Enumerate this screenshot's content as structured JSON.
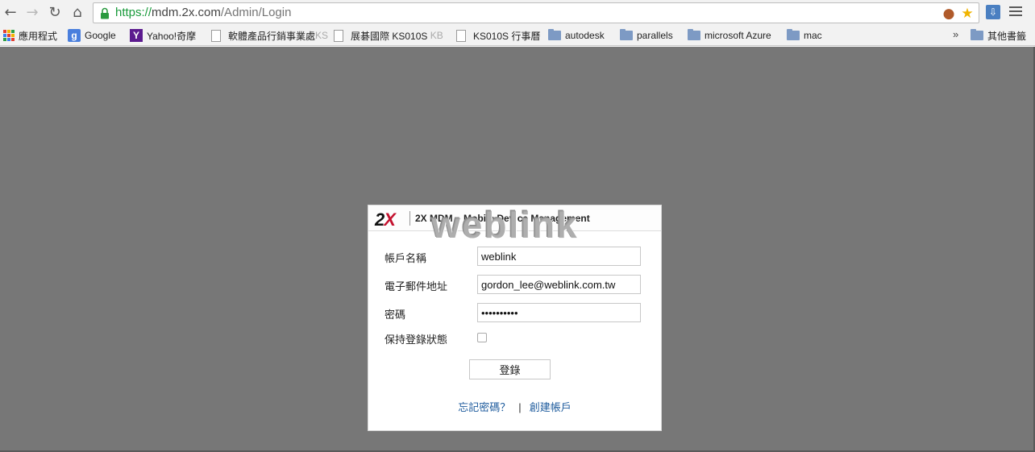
{
  "browser": {
    "url_scheme": "https://",
    "url_host": "mdm.2x.com",
    "url_path": "/Admin/Login",
    "icons": [
      "back-icon",
      "forward-icon",
      "reload-icon",
      "home-icon",
      "lock-icon",
      "extension-icon",
      "star-icon",
      "download-icon",
      "menu-icon"
    ]
  },
  "bookmarks": {
    "items": [
      {
        "label": "應用程式",
        "icon": "apps-icon"
      },
      {
        "label": "Google",
        "icon": "google-icon"
      },
      {
        "label": "Yahoo!奇摩",
        "icon": "yahoo-icon"
      },
      {
        "label": "軟體產品行銷事業處",
        "label_faded": "KS",
        "icon": "page-icon"
      },
      {
        "label": "展碁國際 KS010S",
        "label_faded": "KB",
        "icon": "page-icon"
      },
      {
        "label": "KS010S 行事曆",
        "icon": "page-icon"
      },
      {
        "label": "autodesk",
        "icon": "folder-icon"
      },
      {
        "label": "parallels",
        "icon": "folder-icon"
      },
      {
        "label": "microsoft Azure",
        "icon": "folder-icon"
      },
      {
        "label": "mac",
        "icon": "folder-icon"
      }
    ],
    "overflow": "»",
    "other": "其他書籤"
  },
  "login": {
    "logo_text": "2",
    "logo_x": "X",
    "product": "2X MDM – Mobile Device Management",
    "watermark": "weblink",
    "username_label": "帳戶名稱",
    "username_value": "weblink",
    "email_label": "電子郵件地址",
    "email_value": "gordon_lee@weblink.com.tw",
    "password_label": "密碼",
    "password_value": "••••••••••",
    "remember_label": "保持登錄狀態",
    "submit_label": "登錄",
    "forgot_link": "忘記密碼？",
    "separator": "|",
    "create_link": "創建帳戶"
  }
}
